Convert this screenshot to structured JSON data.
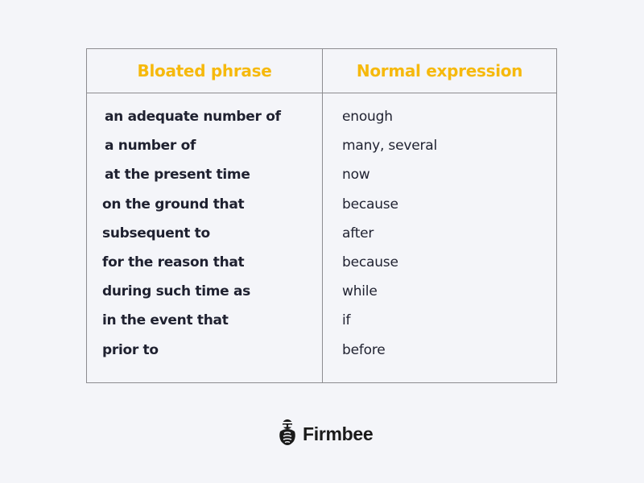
{
  "table": {
    "headers": {
      "left": "Bloated phrase",
      "right": "Normal expression"
    },
    "rows": [
      {
        "bloated": "an adequate number of",
        "normal": "enough"
      },
      {
        "bloated": "a number of",
        "normal": "many, several"
      },
      {
        "bloated": "at the present time",
        "normal": "now"
      },
      {
        "bloated": "on the ground that",
        "normal": "because"
      },
      {
        "bloated": "subsequent to",
        "normal": "after"
      },
      {
        "bloated": "for the reason that",
        "normal": "because"
      },
      {
        "bloated": "during such time as",
        "normal": "while"
      },
      {
        "bloated": "in the event that",
        "normal": "if"
      },
      {
        "bloated": "prior to",
        "normal": "before"
      }
    ]
  },
  "brand": {
    "name": "Firmbee",
    "icon": "bee-mascot-icon"
  },
  "colors": {
    "header_text": "#f6b90c",
    "body_text": "#1f2130",
    "border": "#8c8c90",
    "background": "#f4f5f9"
  }
}
